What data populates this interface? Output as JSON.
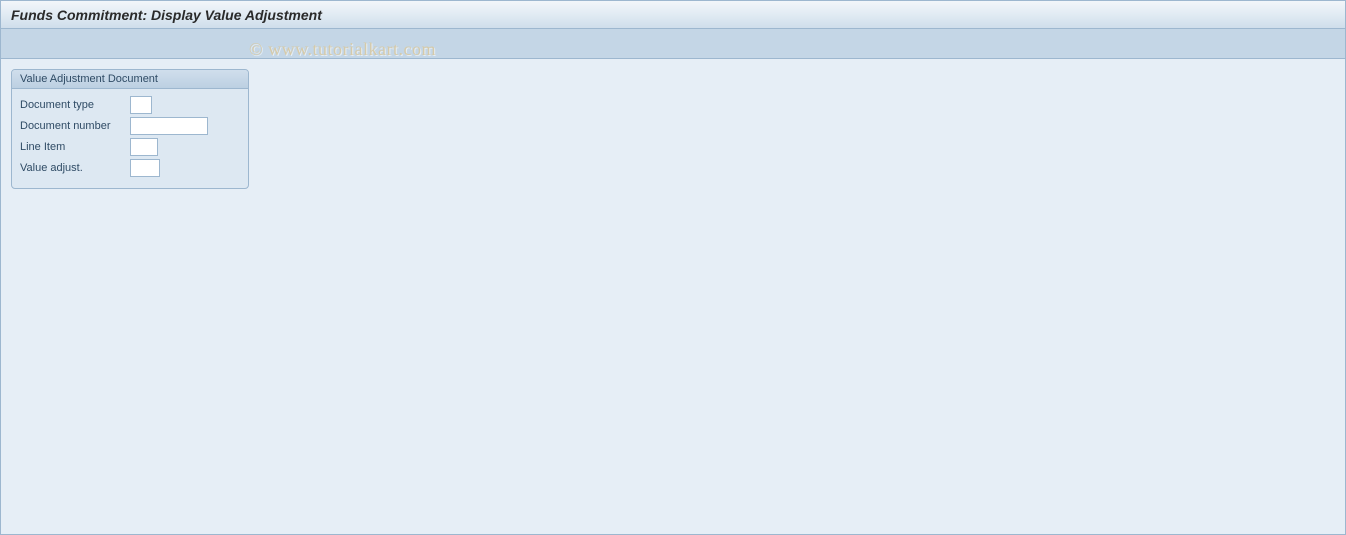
{
  "header": {
    "title": "Funds Commitment: Display Value Adjustment"
  },
  "watermark": "© www.tutorialkart.com",
  "group": {
    "title": "Value Adjustment Document",
    "fields": {
      "doc_type": {
        "label": "Document type",
        "value": ""
      },
      "doc_number": {
        "label": "Document number",
        "value": ""
      },
      "line_item": {
        "label": "Line Item",
        "value": ""
      },
      "value_adj": {
        "label": "Value adjust.",
        "value": ""
      }
    }
  }
}
